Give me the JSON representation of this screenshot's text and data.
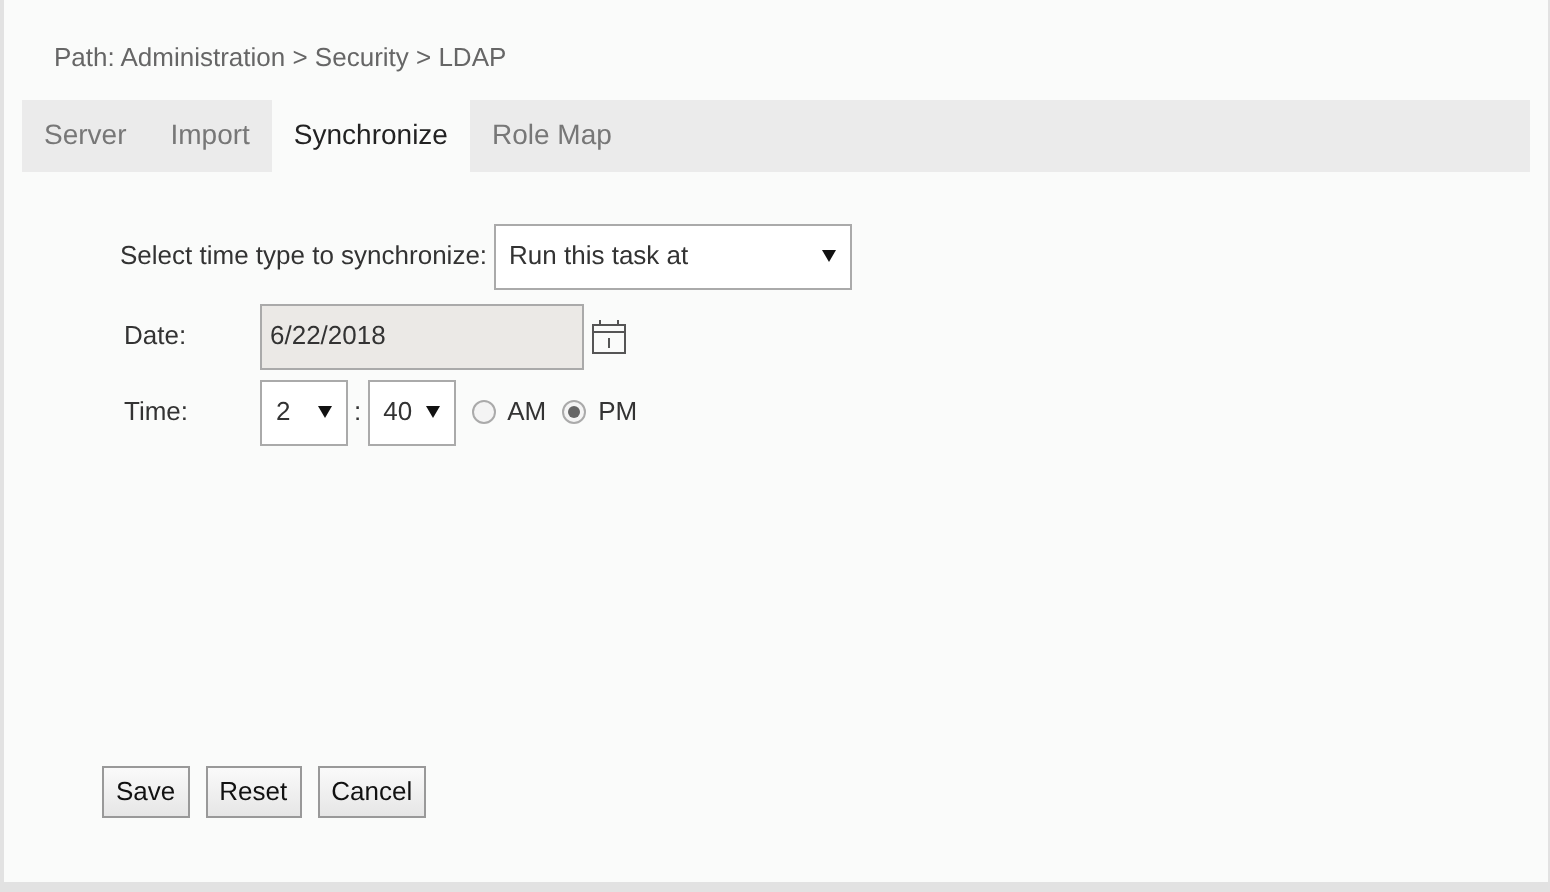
{
  "path": "Path: Administration > Security > LDAP",
  "tabs": [
    {
      "label": "Server",
      "selected": false
    },
    {
      "label": "Import",
      "selected": false
    },
    {
      "label": "Synchronize",
      "selected": true
    },
    {
      "label": "Role Map",
      "selected": false
    }
  ],
  "time_type": {
    "label": "Select time type to synchronize:",
    "value": "Run this task at"
  },
  "date": {
    "label": "Date:",
    "value": "6/22/2018",
    "disabled": true
  },
  "time": {
    "label": "Time:",
    "hour": "2",
    "separator": ":",
    "minute": "40",
    "periods": [
      {
        "label": "AM",
        "selected": false
      },
      {
        "label": "PM",
        "selected": true
      }
    ]
  },
  "buttons": [
    "Save",
    "Reset",
    "Cancel"
  ]
}
